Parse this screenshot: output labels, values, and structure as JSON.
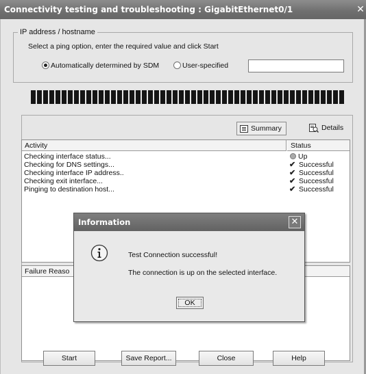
{
  "window": {
    "title": "Connectivity testing and troubleshooting : GigabitEthernet0/1",
    "close_glyph": "✕"
  },
  "ip_group": {
    "legend": "IP address / hostname",
    "instruction": "Select a ping option, enter the required value and click Start",
    "option_auto": "Automatically determined by SDM",
    "option_user": "User-specified",
    "selected_option": "auto",
    "user_value": ""
  },
  "progress": {
    "fraction": 1.0
  },
  "view_tabs": {
    "summary": "Summary",
    "details": "Details",
    "selected": "summary"
  },
  "activity_table": {
    "col_activity": "Activity",
    "col_status": "Status",
    "rows": [
      {
        "activity": "Checking interface status...",
        "status": "Up",
        "status_icon": "up-indicator-icon"
      },
      {
        "activity": "Checking for DNS settings...",
        "status": "Successful",
        "status_icon": "checkmark-icon"
      },
      {
        "activity": "Checking interface IP address..",
        "status": "Successful",
        "status_icon": "checkmark-icon"
      },
      {
        "activity": "Checking exit interface...",
        "status": "Successful",
        "status_icon": "checkmark-icon"
      },
      {
        "activity": "Pinging to destination host...",
        "status": "Successful",
        "status_icon": "checkmark-icon"
      }
    ]
  },
  "failure_section": {
    "header": "Failure Reaso"
  },
  "dialog": {
    "title": "Information",
    "message": "Test Connection successful!",
    "detail": "The connection is up on the selected interface.",
    "ok": "OK",
    "icon": "information-icon"
  },
  "buttons": {
    "start": "Start",
    "save_report": "Save Report...",
    "close": "Close",
    "help": "Help"
  }
}
